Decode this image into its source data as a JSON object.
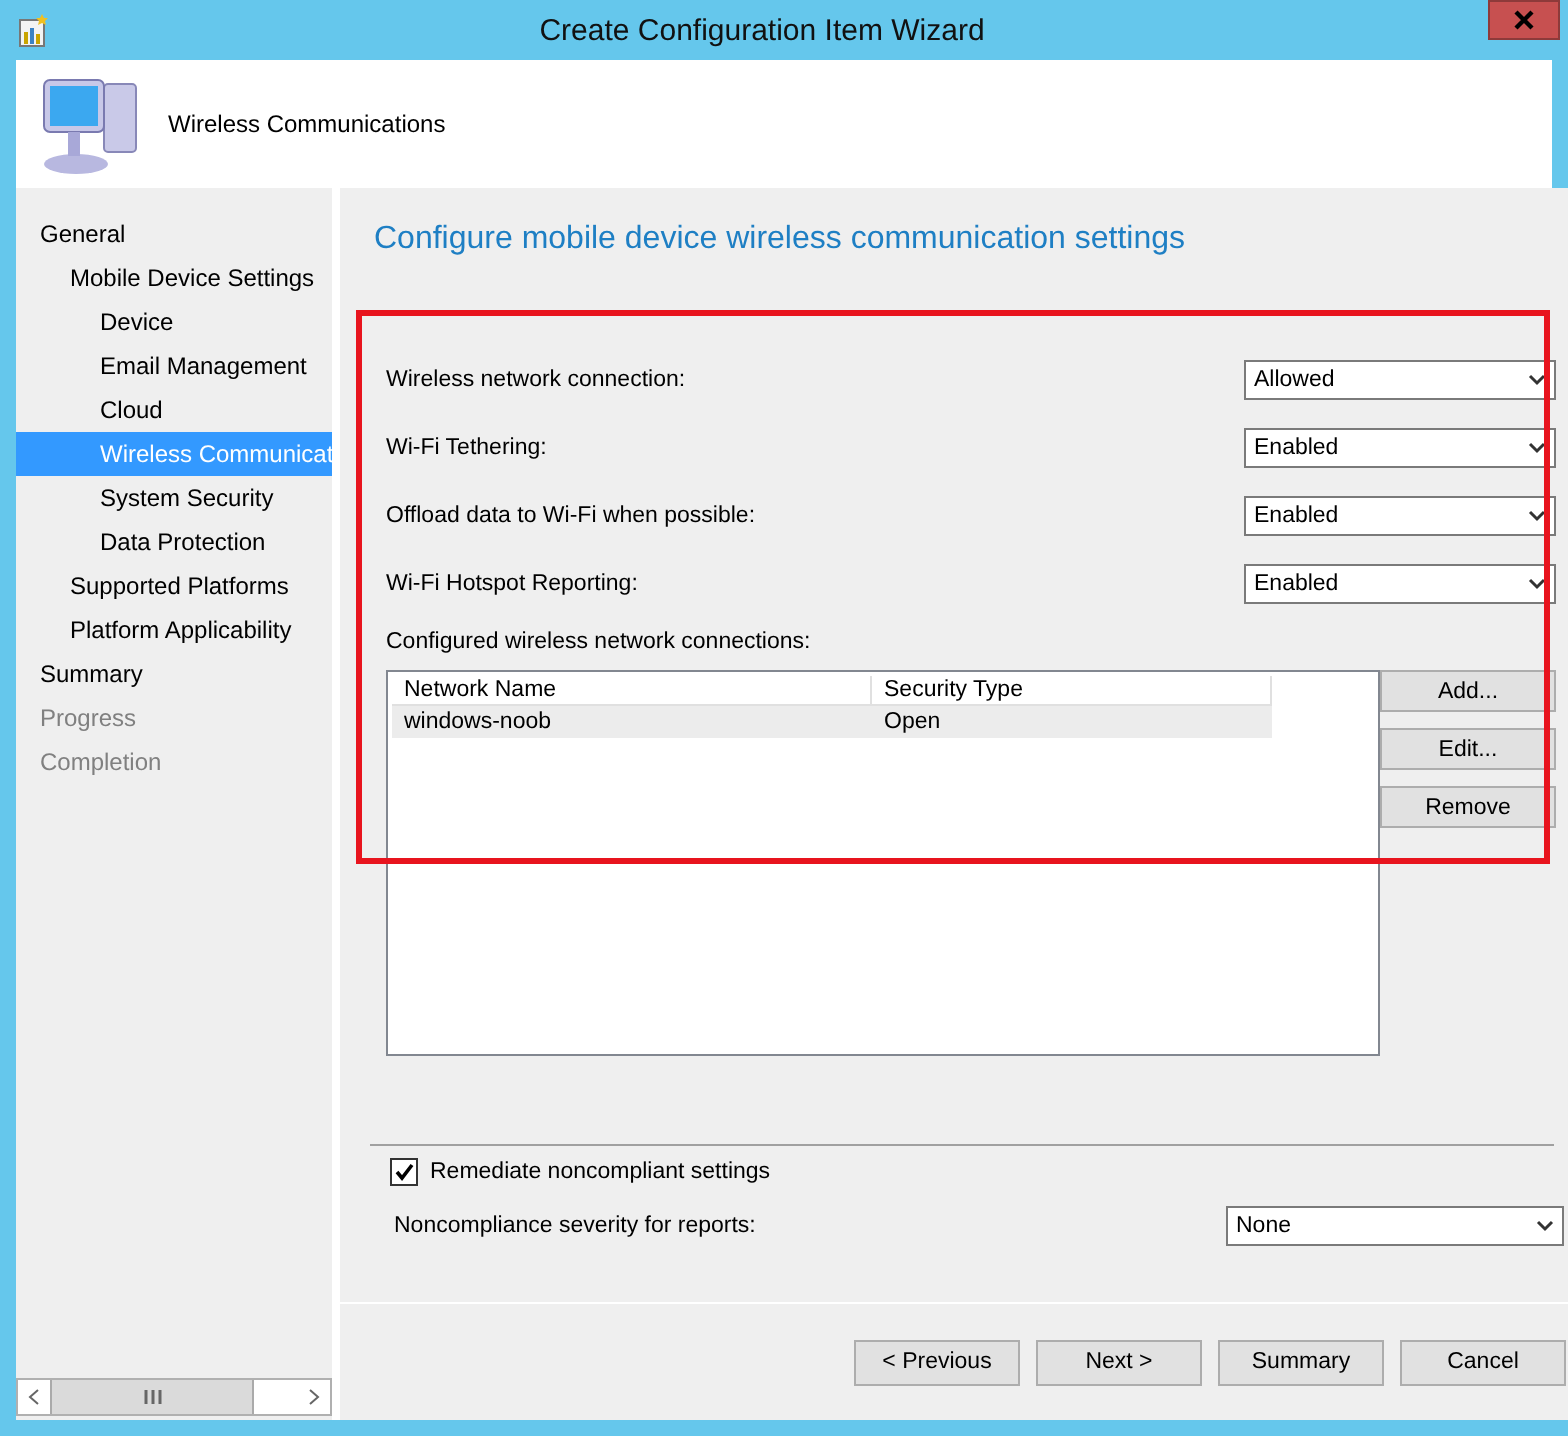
{
  "window": {
    "title": "Create Configuration Item Wizard"
  },
  "header": {
    "title": "Wireless Communications"
  },
  "nav": [
    {
      "label": "General",
      "selected": false,
      "disabled": false,
      "children": [
        {
          "label": "Mobile Device Settings",
          "selected": false,
          "disabled": false,
          "children": [
            {
              "label": "Device",
              "selected": false,
              "disabled": false
            },
            {
              "label": "Email Management",
              "selected": false,
              "disabled": false
            },
            {
              "label": "Cloud",
              "selected": false,
              "disabled": false
            },
            {
              "label": "Wireless Communicat",
              "selected": true,
              "disabled": false
            },
            {
              "label": "System Security",
              "selected": false,
              "disabled": false
            },
            {
              "label": "Data Protection",
              "selected": false,
              "disabled": false
            }
          ]
        },
        {
          "label": "Supported Platforms",
          "selected": false,
          "disabled": false
        },
        {
          "label": "Platform Applicability",
          "selected": false,
          "disabled": false
        }
      ]
    },
    {
      "label": "Summary",
      "selected": false,
      "disabled": false
    },
    {
      "label": "Progress",
      "selected": false,
      "disabled": true
    },
    {
      "label": "Completion",
      "selected": false,
      "disabled": true
    }
  ],
  "page_title": "Configure mobile device wireless communication settings",
  "settings": [
    {
      "label": "Wireless network connection:",
      "value": "Allowed"
    },
    {
      "label": "Wi-Fi Tethering:",
      "value": "Enabled"
    },
    {
      "label": "Offload data to Wi-Fi when possible:",
      "value": "Enabled"
    },
    {
      "label": "Wi-Fi Hotspot Reporting:",
      "value": "Enabled"
    }
  ],
  "connections": {
    "label": "Configured wireless network connections:",
    "columns": [
      "Network Name",
      "Security Type"
    ],
    "rows": [
      {
        "cells": [
          "windows-noob",
          "Open"
        ],
        "selected": true
      }
    ],
    "buttons": [
      "Add...",
      "Edit...",
      "Remove"
    ]
  },
  "remediate": {
    "label": "Remediate noncompliant settings",
    "checked": true
  },
  "severity": {
    "label": "Noncompliance severity for reports:",
    "value": "None"
  },
  "footer_buttons": [
    "< Previous",
    "Next >",
    "Summary",
    "Cancel"
  ]
}
